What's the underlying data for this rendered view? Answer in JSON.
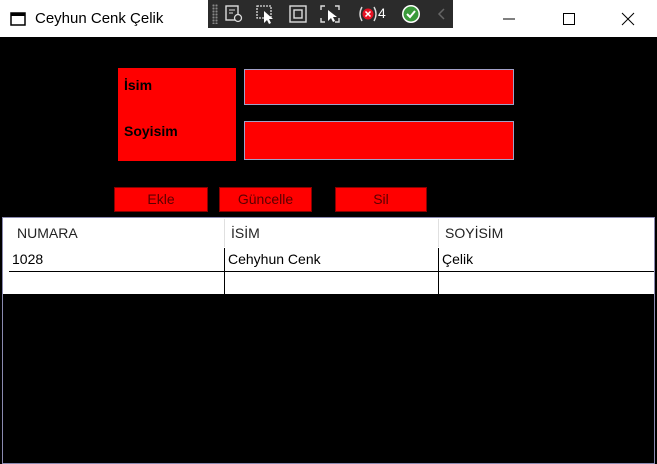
{
  "window": {
    "title": "Ceyhun Cenk Çelik",
    "minimize": "minimize",
    "maximize": "maximize",
    "close": "close"
  },
  "devtools": {
    "error_count": "4"
  },
  "form": {
    "isim_label": "İsim",
    "soyisim_label": "Soyisim",
    "isim_value": "",
    "soyisim_value": ""
  },
  "buttons": {
    "add": "Ekle",
    "update": "Güncelle",
    "delete": "Sil"
  },
  "table": {
    "columns": [
      "NUMARA",
      "İSİM",
      "SOYİSİM"
    ],
    "rows": [
      [
        "1028",
        "Cehyhun Cenk",
        "Çelik"
      ],
      [
        "",
        "",
        ""
      ]
    ]
  },
  "colors": {
    "accent": "#ff0000",
    "background": "#000000"
  }
}
